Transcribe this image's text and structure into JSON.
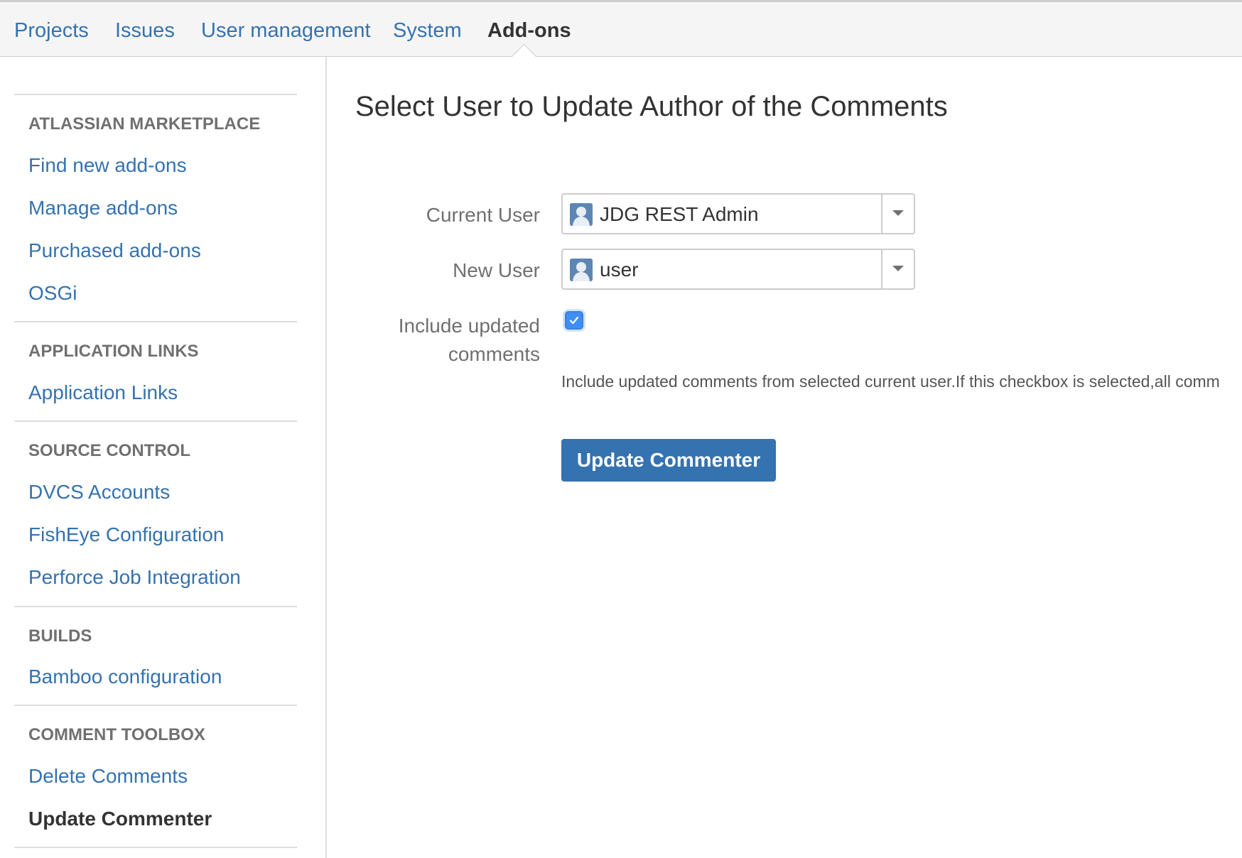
{
  "topnav": {
    "tabs": [
      {
        "label": "Projects"
      },
      {
        "label": "Issues"
      },
      {
        "label": "User management"
      },
      {
        "label": "System"
      },
      {
        "label": "Add-ons"
      }
    ],
    "active_tab": "Add-ons"
  },
  "sidebar": {
    "sections": [
      {
        "heading": "ATLASSIAN MARKETPLACE",
        "items": [
          "Find new add-ons",
          "Manage add-ons",
          "Purchased add-ons",
          "OSGi"
        ]
      },
      {
        "heading": "APPLICATION LINKS",
        "items": [
          "Application Links"
        ]
      },
      {
        "heading": "SOURCE CONTROL",
        "items": [
          "DVCS Accounts",
          "FishEye Configuration",
          "Perforce Job Integration"
        ]
      },
      {
        "heading": "BUILDS",
        "items": [
          "Bamboo configuration"
        ]
      },
      {
        "heading": "COMMENT TOOLBOX",
        "items": [
          "Delete Comments",
          "Update Commenter"
        ]
      }
    ],
    "current_item": "Update Commenter"
  },
  "main": {
    "title": "Select User to Update Author of the Comments",
    "current_user": {
      "label": "Current User",
      "value": "JDG REST Admin"
    },
    "new_user": {
      "label": "New User",
      "value": "user"
    },
    "include_updated": {
      "label_line1": "Include updated",
      "label_line2": "comments",
      "checked": true,
      "help": "Include updated comments from selected current user.If this checkbox is selected,all comm"
    },
    "submit_label": "Update Commenter"
  },
  "colors": {
    "link": "#3572b0",
    "primary_button": "#3572b0",
    "checkbox": "#3f8ef7",
    "text": "#333333",
    "muted": "#707070"
  }
}
